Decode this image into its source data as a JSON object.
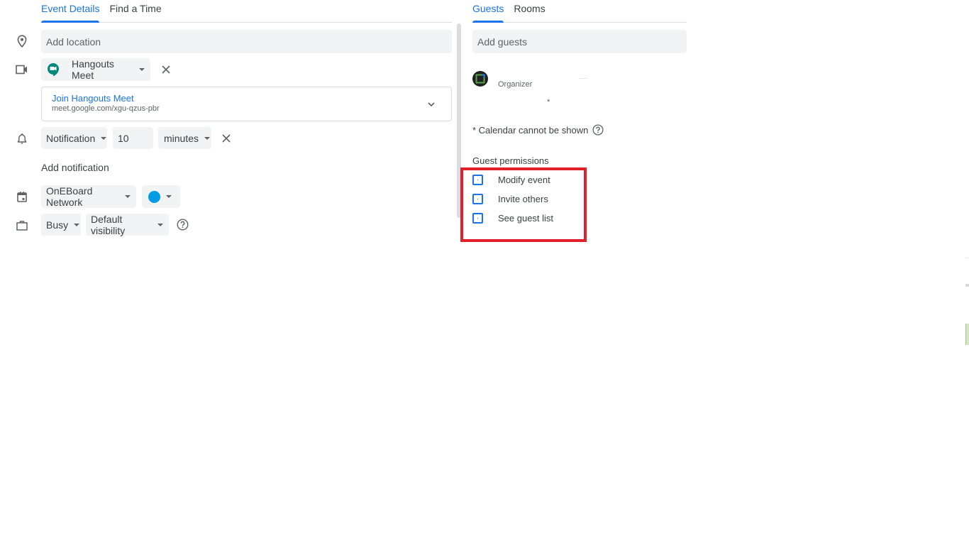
{
  "left_tabs": [
    {
      "label": "Event Details",
      "active": true
    },
    {
      "label": "Find a Time",
      "active": false
    }
  ],
  "right_tabs": [
    {
      "label": "Guests",
      "active": true
    },
    {
      "label": "Rooms",
      "active": false
    }
  ],
  "location": {
    "placeholder": "Add location",
    "icon": "location-pin-icon"
  },
  "conference": {
    "icon": "video-camera-icon",
    "provider_label": "Hangouts Meet",
    "join_label": "Join Hangouts Meet",
    "meet_url": "meet.google.com/xgu-qzus-pbr"
  },
  "notification": {
    "icon": "bell-icon",
    "type": "Notification",
    "amount": "10",
    "unit": "minutes",
    "add_label": "Add notification"
  },
  "calendar": {
    "icon": "calendar-icon",
    "name": "OnEBoard Network",
    "color": "#039be5"
  },
  "availability": {
    "icon": "briefcase-icon",
    "status": "Busy",
    "visibility": "Default visibility"
  },
  "guests": {
    "placeholder": "Add guests",
    "organizer_label": "Organizer",
    "asterisk": "*",
    "calendar_note": "* Calendar cannot be shown",
    "permissions_title": "Guest permissions",
    "permissions": [
      {
        "label": "Modify event",
        "checked": false
      },
      {
        "label": "Invite others",
        "checked": false
      },
      {
        "label": "See guest list",
        "checked": false
      }
    ]
  },
  "colors": {
    "accent": "#1a73e8",
    "highlight": "#e0202a",
    "field_bg": "#f1f3f4"
  }
}
